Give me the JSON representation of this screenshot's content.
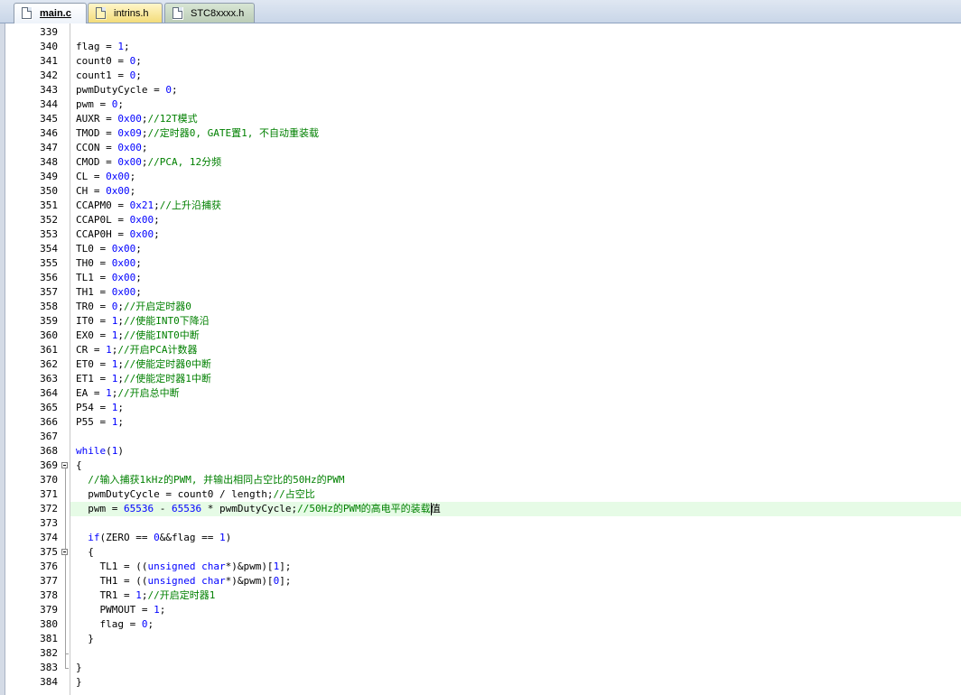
{
  "tabs": [
    {
      "label": "main.c",
      "icon": "c-file-icon",
      "active": true
    },
    {
      "label": "intrins.h",
      "icon": "h-file-icon",
      "active": false
    },
    {
      "label": "STC8xxxx.h",
      "icon": "h-file-icon",
      "active": false
    }
  ],
  "editor": {
    "current_line": "372",
    "colors": {
      "keyword": "#0000ff",
      "number": "#0000ff",
      "comment": "#008000",
      "current_line_bg": "#e6fbe6"
    },
    "lines": [
      {
        "num": "339",
        "tokens": []
      },
      {
        "num": "340",
        "tokens": [
          [
            "t",
            "flag = "
          ],
          [
            "n",
            "1"
          ],
          [
            "t",
            ";"
          ]
        ]
      },
      {
        "num": "341",
        "tokens": [
          [
            "t",
            "count0 = "
          ],
          [
            "n",
            "0"
          ],
          [
            "t",
            ";"
          ]
        ]
      },
      {
        "num": "342",
        "tokens": [
          [
            "t",
            "count1 = "
          ],
          [
            "n",
            "0"
          ],
          [
            "t",
            ";"
          ]
        ]
      },
      {
        "num": "343",
        "tokens": [
          [
            "t",
            "pwmDutyCycle = "
          ],
          [
            "n",
            "0"
          ],
          [
            "t",
            ";"
          ]
        ]
      },
      {
        "num": "344",
        "tokens": [
          [
            "t",
            "pwm = "
          ],
          [
            "n",
            "0"
          ],
          [
            "t",
            ";"
          ]
        ]
      },
      {
        "num": "345",
        "tokens": [
          [
            "t",
            "AUXR = "
          ],
          [
            "n",
            "0x00"
          ],
          [
            "t",
            ";"
          ],
          [
            "c",
            "//12T模式"
          ]
        ]
      },
      {
        "num": "346",
        "tokens": [
          [
            "t",
            "TMOD = "
          ],
          [
            "n",
            "0x09"
          ],
          [
            "t",
            ";"
          ],
          [
            "c",
            "//定时器0, GATE置1, 不自动重装载"
          ]
        ]
      },
      {
        "num": "347",
        "tokens": [
          [
            "t",
            "CCON = "
          ],
          [
            "n",
            "0x00"
          ],
          [
            "t",
            ";"
          ]
        ]
      },
      {
        "num": "348",
        "tokens": [
          [
            "t",
            "CMOD = "
          ],
          [
            "n",
            "0x00"
          ],
          [
            "t",
            ";"
          ],
          [
            "c",
            "//PCA, 12分频"
          ]
        ]
      },
      {
        "num": "349",
        "tokens": [
          [
            "t",
            "CL = "
          ],
          [
            "n",
            "0x00"
          ],
          [
            "t",
            ";"
          ]
        ]
      },
      {
        "num": "350",
        "tokens": [
          [
            "t",
            "CH = "
          ],
          [
            "n",
            "0x00"
          ],
          [
            "t",
            ";"
          ]
        ]
      },
      {
        "num": "351",
        "tokens": [
          [
            "t",
            "CCAPM0 = "
          ],
          [
            "n",
            "0x21"
          ],
          [
            "t",
            ";"
          ],
          [
            "c",
            "//上升沿捕获"
          ]
        ]
      },
      {
        "num": "352",
        "tokens": [
          [
            "t",
            "CCAP0L = "
          ],
          [
            "n",
            "0x00"
          ],
          [
            "t",
            ";"
          ]
        ]
      },
      {
        "num": "353",
        "tokens": [
          [
            "t",
            "CCAP0H = "
          ],
          [
            "n",
            "0x00"
          ],
          [
            "t",
            ";"
          ]
        ]
      },
      {
        "num": "354",
        "tokens": [
          [
            "t",
            "TL0 = "
          ],
          [
            "n",
            "0x00"
          ],
          [
            "t",
            ";"
          ]
        ]
      },
      {
        "num": "355",
        "tokens": [
          [
            "t",
            "TH0 = "
          ],
          [
            "n",
            "0x00"
          ],
          [
            "t",
            ";"
          ]
        ]
      },
      {
        "num": "356",
        "tokens": [
          [
            "t",
            "TL1 = "
          ],
          [
            "n",
            "0x00"
          ],
          [
            "t",
            ";"
          ]
        ]
      },
      {
        "num": "357",
        "tokens": [
          [
            "t",
            "TH1 = "
          ],
          [
            "n",
            "0x00"
          ],
          [
            "t",
            ";"
          ]
        ]
      },
      {
        "num": "358",
        "tokens": [
          [
            "t",
            "TR0 = "
          ],
          [
            "n",
            "0"
          ],
          [
            "t",
            ";"
          ],
          [
            "c",
            "//开启定时器0"
          ]
        ]
      },
      {
        "num": "359",
        "tokens": [
          [
            "t",
            "IT0 = "
          ],
          [
            "n",
            "1"
          ],
          [
            "t",
            ";"
          ],
          [
            "c",
            "//使能INT0下降沿"
          ]
        ]
      },
      {
        "num": "360",
        "tokens": [
          [
            "t",
            "EX0 = "
          ],
          [
            "n",
            "1"
          ],
          [
            "t",
            ";"
          ],
          [
            "c",
            "//使能INT0中断"
          ]
        ]
      },
      {
        "num": "361",
        "tokens": [
          [
            "t",
            "CR = "
          ],
          [
            "n",
            "1"
          ],
          [
            "t",
            ";"
          ],
          [
            "c",
            "//开启PCA计数器"
          ]
        ]
      },
      {
        "num": "362",
        "tokens": [
          [
            "t",
            "ET0 = "
          ],
          [
            "n",
            "1"
          ],
          [
            "t",
            ";"
          ],
          [
            "c",
            "//使能定时器0中断"
          ]
        ]
      },
      {
        "num": "363",
        "tokens": [
          [
            "t",
            "ET1 = "
          ],
          [
            "n",
            "1"
          ],
          [
            "t",
            ";"
          ],
          [
            "c",
            "//使能定时器1中断"
          ]
        ]
      },
      {
        "num": "364",
        "tokens": [
          [
            "t",
            "EA = "
          ],
          [
            "n",
            "1"
          ],
          [
            "t",
            ";"
          ],
          [
            "c",
            "//开启总中断"
          ]
        ]
      },
      {
        "num": "365",
        "tokens": [
          [
            "t",
            "P54 = "
          ],
          [
            "n",
            "1"
          ],
          [
            "t",
            ";"
          ]
        ]
      },
      {
        "num": "366",
        "tokens": [
          [
            "t",
            "P55 = "
          ],
          [
            "n",
            "1"
          ],
          [
            "t",
            ";"
          ]
        ]
      },
      {
        "num": "367",
        "tokens": []
      },
      {
        "num": "368",
        "tokens": [
          [
            "k",
            "while"
          ],
          [
            "t",
            "("
          ],
          [
            "n",
            "1"
          ],
          [
            "t",
            ")"
          ]
        ]
      },
      {
        "num": "369",
        "tokens": [
          [
            "t",
            "{"
          ]
        ]
      },
      {
        "num": "370",
        "tokens": [
          [
            "t",
            "  "
          ],
          [
            "c",
            "//输入捕获1kHz的PWM, 并输出相同占空比的50Hz的PWM"
          ]
        ]
      },
      {
        "num": "371",
        "tokens": [
          [
            "t",
            "  pwmDutyCycle = count0 / length;"
          ],
          [
            "c",
            "//占空比"
          ]
        ]
      },
      {
        "num": "372",
        "tokens": [
          [
            "t",
            "  pwm = "
          ],
          [
            "n",
            "65536"
          ],
          [
            "t",
            " - "
          ],
          [
            "n",
            "65536"
          ],
          [
            "t",
            " * pwmDutyCycle;"
          ],
          [
            "c",
            "//50Hz的PWM的高电平的装载"
          ],
          [
            "t",
            "值"
          ]
        ]
      },
      {
        "num": "373",
        "tokens": []
      },
      {
        "num": "374",
        "tokens": [
          [
            "t",
            "  "
          ],
          [
            "k",
            "if"
          ],
          [
            "t",
            "(ZERO == "
          ],
          [
            "n",
            "0"
          ],
          [
            "t",
            "&&flag == "
          ],
          [
            "n",
            "1"
          ],
          [
            "t",
            ")"
          ]
        ]
      },
      {
        "num": "375",
        "tokens": [
          [
            "t",
            "  {"
          ]
        ]
      },
      {
        "num": "376",
        "tokens": [
          [
            "t",
            "    TL1 = (("
          ],
          [
            "k",
            "unsigned char"
          ],
          [
            "t",
            "*)&pwm)["
          ],
          [
            "n",
            "1"
          ],
          [
            "t",
            "];"
          ]
        ]
      },
      {
        "num": "377",
        "tokens": [
          [
            "t",
            "    TH1 = (("
          ],
          [
            "k",
            "unsigned char"
          ],
          [
            "t",
            "*)&pwm)["
          ],
          [
            "n",
            "0"
          ],
          [
            "t",
            "];"
          ]
        ]
      },
      {
        "num": "378",
        "tokens": [
          [
            "t",
            "    TR1 = "
          ],
          [
            "n",
            "1"
          ],
          [
            "t",
            ";"
          ],
          [
            "c",
            "//开启定时器1"
          ]
        ]
      },
      {
        "num": "379",
        "tokens": [
          [
            "t",
            "    PWMOUT = "
          ],
          [
            "n",
            "1"
          ],
          [
            "t",
            ";"
          ]
        ]
      },
      {
        "num": "380",
        "tokens": [
          [
            "t",
            "    flag = "
          ],
          [
            "n",
            "0"
          ],
          [
            "t",
            ";"
          ]
        ]
      },
      {
        "num": "381",
        "tokens": [
          [
            "t",
            "  }"
          ]
        ]
      },
      {
        "num": "382",
        "tokens": []
      },
      {
        "num": "383",
        "tokens": [
          [
            "t",
            "}"
          ]
        ]
      },
      {
        "num": "384",
        "tokens": [
          [
            "t",
            "}"
          ]
        ]
      }
    ]
  }
}
